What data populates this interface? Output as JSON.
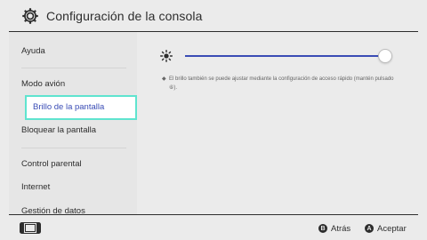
{
  "header": {
    "title": "Configuración de la consola",
    "icon": "gear-icon"
  },
  "sidebar": {
    "items": [
      {
        "label": "Ayuda"
      },
      {
        "label": "Modo avión"
      },
      {
        "label": "Brillo de la pantalla",
        "selected": true
      },
      {
        "label": "Bloquear la pantalla"
      },
      {
        "label": "Control parental"
      },
      {
        "label": "Internet"
      },
      {
        "label": "Gestión de datos"
      }
    ]
  },
  "main": {
    "brightness_icon": "sun-icon",
    "brightness_level": 1.0,
    "note_bullet": "◆",
    "note": "El brillo también se puede ajustar mediante la configuración de acceso rápido (mantén pulsado ⑥)."
  },
  "footer": {
    "console_icon": "console-icon",
    "back_key": "B",
    "back_label": "Atrás",
    "accept_key": "A",
    "accept_label": "Aceptar"
  },
  "colors": {
    "background": "#ebebeb",
    "accent": "#3a4cb5",
    "selection_border": "#5fe4cf",
    "text": "#2d2d2d"
  }
}
